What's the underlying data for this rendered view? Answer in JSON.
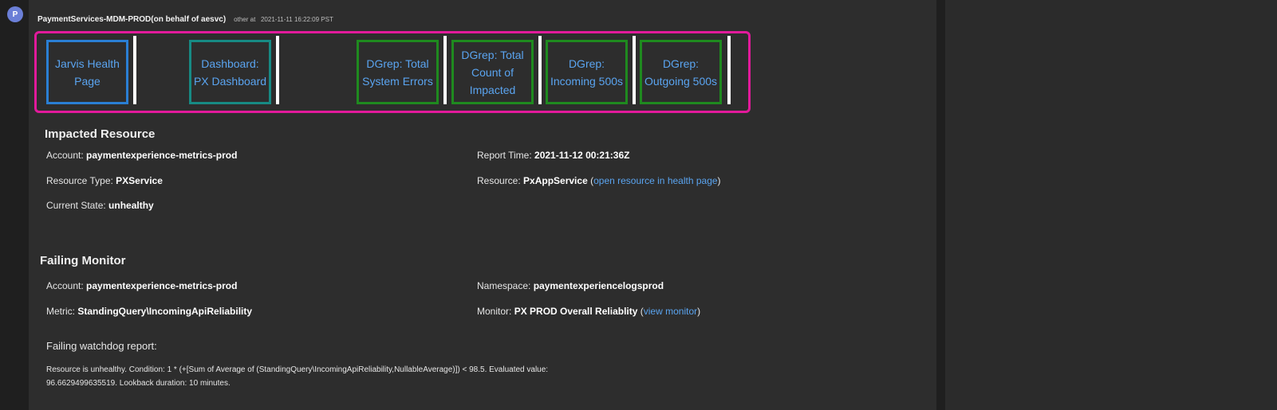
{
  "avatar": {
    "initial": "P"
  },
  "header": {
    "sender": "PaymentServices-MDM-PROD(on behalf of aesvc)",
    "meta_prefix": "other at",
    "timestamp": "2021-11-11 16:22:09 PST"
  },
  "buttons": [
    {
      "label": "Jarvis Health Page",
      "color": "#2a7fd4"
    },
    {
      "label": "Dashboard: PX Dashboard",
      "color": "#178a84"
    },
    {
      "label": "DGrep: Total System Errors",
      "color": "#1f8a1f"
    },
    {
      "label": "DGrep: Total Count of Impacted",
      "color": "#1f8a1f"
    },
    {
      "label": "DGrep: Incoming 500s",
      "color": "#1f8a1f"
    },
    {
      "label": "DGrep: Outgoing 500s",
      "color": "#1f8a1f"
    }
  ],
  "impacted": {
    "title": "Impacted Resource",
    "account_label": "Account: ",
    "account_value": "paymentexperience-metrics-prod",
    "resource_type_label": "Resource Type: ",
    "resource_type_value": "PXService",
    "state_label": "Current State: ",
    "state_value": "unhealthy",
    "report_time_label": "Report Time: ",
    "report_time_value": "2021-11-12 00:21:36Z",
    "resource_label": "Resource: ",
    "resource_value": "PxAppService",
    "open_paren": " (",
    "resource_link": "open resource in health page",
    "close_paren": ")"
  },
  "failing": {
    "title": "Failing Monitor",
    "account_label": "Account: ",
    "account_value": "paymentexperience-metrics-prod",
    "metric_label": "Metric: ",
    "metric_value": "StandingQuery\\IncomingApiReliability",
    "namespace_label": "Namespace: ",
    "namespace_value": "paymentexperiencelogsprod",
    "monitor_label": "Monitor: ",
    "monitor_value": "PX PROD Overall Reliablity",
    "open_paren": " (",
    "monitor_link": "view monitor",
    "close_paren": ")",
    "report_label": "Failing watchdog report:",
    "report_line1": "Resource is unhealthy. Condition: 1 * (+[Sum of Average of (StandingQuery\\IncomingApiReliability,NullableAverage)]) < 98.5. Evaluated value:",
    "report_line2": "96.6629499635519. Lookback duration: 10 minutes."
  }
}
